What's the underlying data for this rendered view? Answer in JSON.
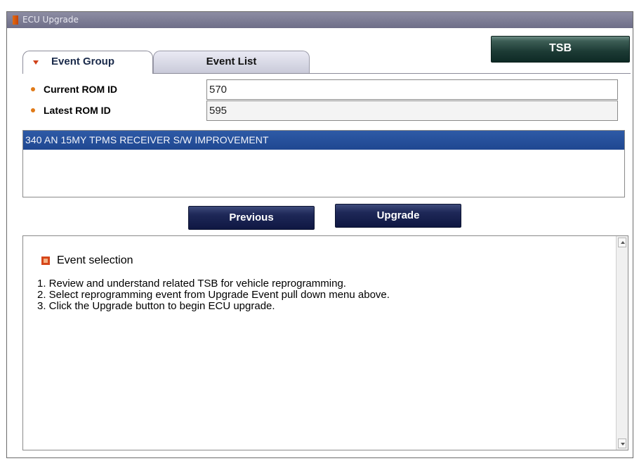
{
  "window": {
    "title": "ECU Upgrade"
  },
  "toolbar": {
    "tsb_label": "TSB"
  },
  "tabs": [
    {
      "label": "Event Group",
      "active": true
    },
    {
      "label": "Event List",
      "active": false
    }
  ],
  "fields": {
    "current_rom": {
      "label": "Current ROM ID",
      "value": "570"
    },
    "latest_rom": {
      "label": "Latest ROM ID",
      "value": "595"
    }
  },
  "events": [
    {
      "label": "340 AN 15MY TPMS RECEIVER S/W IMPROVEMENT",
      "selected": true
    }
  ],
  "buttons": {
    "previous": "Previous",
    "upgrade": "Upgrade"
  },
  "message": {
    "heading": "Event selection",
    "steps": [
      "1. Review and understand related TSB for vehicle reprogramming.",
      "2. Select reprogramming event from Upgrade Event pull down menu above.",
      "3. Click the Upgrade button to begin ECU upgrade."
    ]
  },
  "colors": {
    "title_bar": "#7a7a94",
    "selection": "#2a52a0",
    "tsb_button": "#1c3a34",
    "action_button": "#1e2858",
    "bullet": "#e07a18"
  }
}
